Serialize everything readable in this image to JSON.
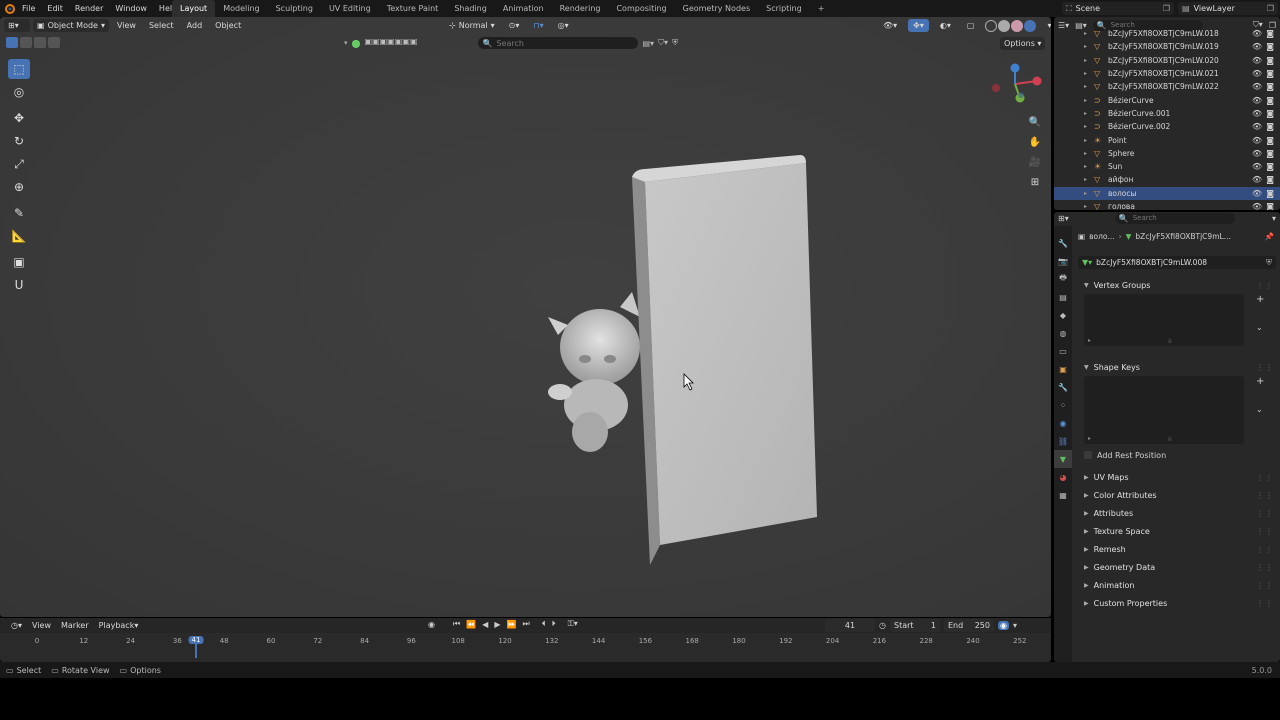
{
  "topbar": {
    "menus": [
      "File",
      "Edit",
      "Render",
      "Window",
      "Help"
    ],
    "workspaces": [
      "Layout",
      "Modeling",
      "Sculpting",
      "UV Editing",
      "Texture Paint",
      "Shading",
      "Animation",
      "Rendering",
      "Compositing",
      "Geometry Nodes",
      "Scripting"
    ],
    "add_tab": "+",
    "scene": "Scene",
    "view_layer": "ViewLayer"
  },
  "viewport": {
    "mode": "Object Mode",
    "menus": [
      "View",
      "Select",
      "Add",
      "Object"
    ],
    "orientation": "Normal",
    "search_placeholder": "Search",
    "options": "Options"
  },
  "timeline": {
    "menus": [
      "View",
      "Marker",
      "Playback"
    ],
    "current_frame": "41",
    "start_label": "Start",
    "start": "1",
    "end_label": "End",
    "end": "250",
    "ticks": [
      "0",
      "12",
      "24",
      "36",
      "48",
      "60",
      "72",
      "84",
      "96",
      "108",
      "120",
      "132",
      "144",
      "156",
      "168",
      "180",
      "192",
      "204",
      "216",
      "228",
      "240",
      "252"
    ]
  },
  "statusbar": {
    "select": "Select",
    "rotate": "Rotate View",
    "options": "Options",
    "version": "5.0.0"
  },
  "outliner": {
    "search_placeholder": "Search",
    "rows": [
      {
        "name": "bZcJyF5Xfi8OXBTjC9mLW.018",
        "type": "mesh"
      },
      {
        "name": "bZcJyF5Xfi8OXBTjC9mLW.019",
        "type": "mesh"
      },
      {
        "name": "bZcJyF5Xfi8OXBTjC9mLW.020",
        "type": "mesh"
      },
      {
        "name": "bZcJyF5Xfi8OXBTjC9mLW.021",
        "type": "mesh"
      },
      {
        "name": "bZcJyF5Xfi8OXBTjC9mLW.022",
        "type": "mesh"
      },
      {
        "name": "BézierCurve",
        "type": "curve"
      },
      {
        "name": "BézierCurve.001",
        "type": "curve"
      },
      {
        "name": "BézierCurve.002",
        "type": "curve"
      },
      {
        "name": "Point",
        "type": "light"
      },
      {
        "name": "Sphere",
        "type": "mesh"
      },
      {
        "name": "Sun",
        "type": "light"
      },
      {
        "name": "айфон",
        "type": "mesh"
      },
      {
        "name": "волосы",
        "type": "mesh"
      },
      {
        "name": "голова",
        "type": "mesh"
      }
    ]
  },
  "properties": {
    "search_placeholder": "Search",
    "breadcrumb_object": "воло...",
    "breadcrumb_data": "bZcJyF5Xfi8OXBTjC9mL...",
    "data_name": "bZcJyF5Xfi8OXBTjC9mLW.008",
    "panels": {
      "vertex_groups": "Vertex Groups",
      "shape_keys": "Shape Keys",
      "add_rest_position": "Add Rest Position",
      "uv_maps": "UV Maps",
      "color_attributes": "Color Attributes",
      "attributes": "Attributes",
      "texture_space": "Texture Space",
      "remesh": "Remesh",
      "geometry_data": "Geometry Data",
      "animation": "Animation",
      "custom_properties": "Custom Properties"
    }
  },
  "colors": {
    "accent": "#4772b3",
    "selected_row": "#334d80",
    "mesh_icon": "#e0a050",
    "data_icon": "#5fbf5f"
  }
}
